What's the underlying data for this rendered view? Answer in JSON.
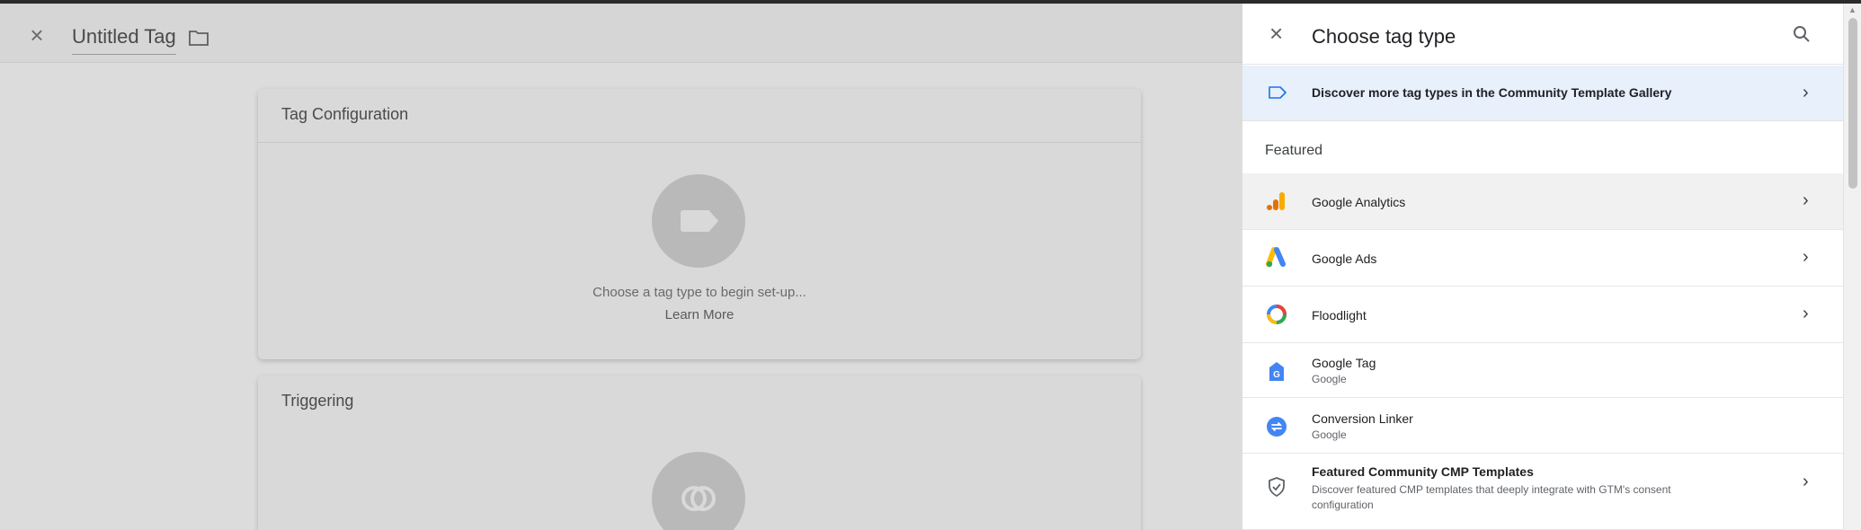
{
  "editor": {
    "title": "Untitled Tag",
    "close_icon": "close-icon",
    "folder_icon": "folder-icon",
    "tag_config": {
      "title": "Tag Configuration",
      "hint": "Choose a tag type to begin set-up...",
      "learn_more": "Learn More"
    },
    "triggering": {
      "title": "Triggering"
    }
  },
  "panel": {
    "title": "Choose tag type",
    "discover_label": "Discover more tag types in the Community Template Gallery",
    "section_featured": "Featured",
    "items": [
      {
        "label": "Google Analytics",
        "icon": "google-analytics-icon"
      },
      {
        "label": "Google Ads",
        "icon": "google-ads-icon"
      },
      {
        "label": "Floodlight",
        "icon": "floodlight-icon"
      },
      {
        "label": "Google Tag",
        "sub": "Google",
        "icon": "google-tag-icon"
      },
      {
        "label": "Conversion Linker",
        "sub": "Google",
        "icon": "conversion-linker-icon"
      },
      {
        "label": "Featured Community CMP Templates",
        "desc": "Discover featured CMP templates that deeply integrate with GTM's consent configuration",
        "icon": "shield-check-icon"
      }
    ]
  },
  "colors": {
    "accent_blue": "#1a73e8",
    "discover_bg": "#e8f0fb",
    "analytics_orange": "#f9ab00",
    "analytics_dark": "#e37400"
  }
}
